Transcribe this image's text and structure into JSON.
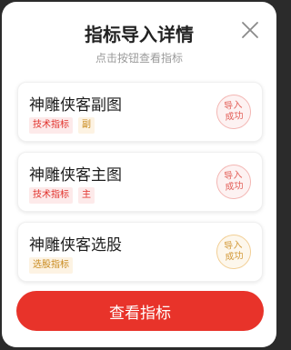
{
  "dialog": {
    "title": "指标导入详情",
    "subtitle": "点击按钮查看指标",
    "close_icon": "close-icon"
  },
  "cards": [
    {
      "name": "神雕侠客副图",
      "tags": [
        {
          "label": "技术指标",
          "color": "#e1312b"
        },
        {
          "label": "副",
          "color": "#c98a1d"
        }
      ],
      "status": "导入\n成功",
      "status_color": "#e36059"
    },
    {
      "name": "神雕侠客主图",
      "tags": [
        {
          "label": "技术指标",
          "color": "#e1312b"
        },
        {
          "label": "主",
          "color": "#e1312b"
        }
      ],
      "status": "导入\n成功",
      "status_color": "#e36059"
    },
    {
      "name": "神雕侠客选股",
      "tags": [
        {
          "label": "选股指标",
          "color": "#c98a1d"
        }
      ],
      "status": "导入\n成功",
      "status_color": "#d39a3a"
    }
  ],
  "footer": {
    "button_label": "查看指标",
    "button_color": "#e8332a"
  }
}
